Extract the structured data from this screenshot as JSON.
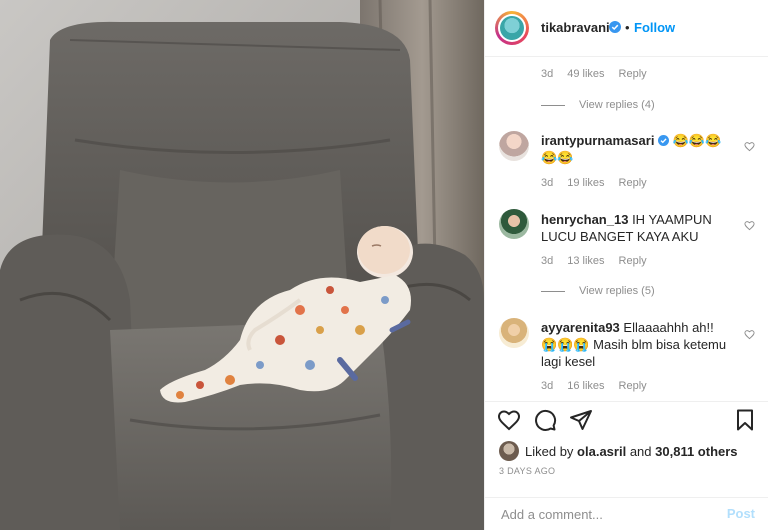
{
  "post": {
    "username": "tikabravani",
    "follow_label": "Follow",
    "separator": "•"
  },
  "comments": {
    "top_meta": {
      "age": "3d",
      "likes": "49 likes",
      "reply": "Reply"
    },
    "view_replies_1": "View replies (4)",
    "items": [
      {
        "username": "irantypurnamasari",
        "text": "😂😂😂 😂😂",
        "age": "3d",
        "likes": "19 likes",
        "reply": "Reply"
      },
      {
        "username": "henrychan_13",
        "text": "IH YAAMPUN LUCU BANGET KAYA AKU",
        "age": "3d",
        "likes": "13 likes",
        "reply": "Reply"
      },
      {
        "username": "ayyarenita93",
        "text": "Ellaaaahhh ah!! 😭😭😭 Masih blm bisa ketemu lagi kesel",
        "age": "3d",
        "likes": "16 likes",
        "reply": "Reply"
      }
    ],
    "view_replies_2": "View replies (5)"
  },
  "likes": {
    "prefix": "Liked by",
    "user": "ola.asril",
    "connector": "and",
    "others": "30,811 others"
  },
  "timestamp": "3 DAYS AGO",
  "add_comment": {
    "placeholder": "Add a comment...",
    "post_label": "Post"
  },
  "colors": {
    "accent": "#0095f6",
    "text": "#262626",
    "muted": "#8e8e8e"
  },
  "icons": [
    "verified-badge-icon",
    "heart-icon",
    "comment-icon",
    "share-icon",
    "bookmark-icon"
  ]
}
